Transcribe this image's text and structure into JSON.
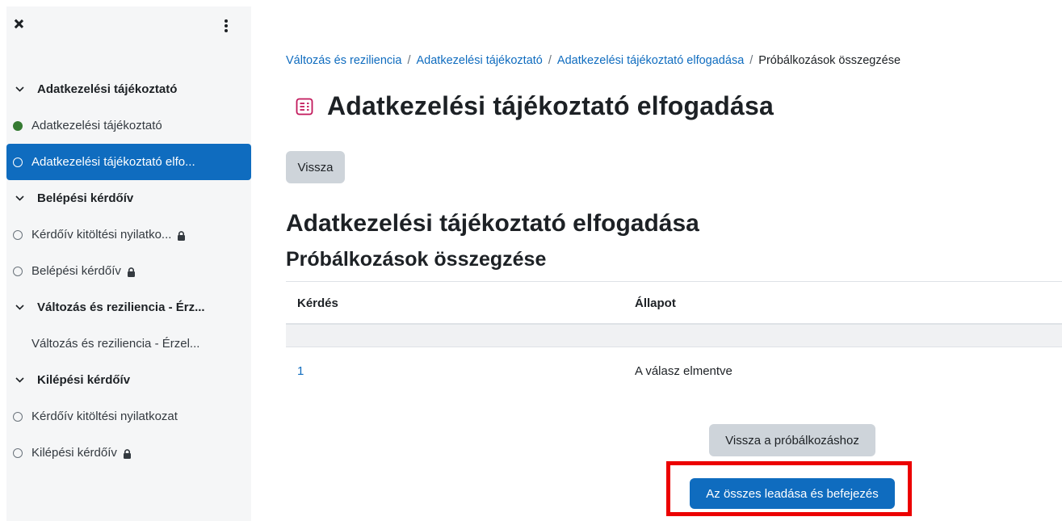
{
  "sidebar": {
    "items": [
      {
        "type": "section",
        "label": "Adatkezelési tájékoztató"
      },
      {
        "type": "item",
        "status": "done",
        "label": "Adatkezelési tájékoztató",
        "locked": false
      },
      {
        "type": "item",
        "status": "active",
        "label": "Adatkezelési tájékoztató elfo...",
        "locked": false
      },
      {
        "type": "section",
        "label": "Belépési kérdőív"
      },
      {
        "type": "item",
        "status": "empty",
        "label": "Kérdőív kitöltési nyilatko...",
        "locked": true
      },
      {
        "type": "item",
        "status": "empty",
        "label": "Belépési kérdőív",
        "locked": true
      },
      {
        "type": "section",
        "label": "Változás és reziliencia - Érz..."
      },
      {
        "type": "item",
        "status": "none",
        "label": "Változás és reziliencia - Érzel...",
        "locked": false
      },
      {
        "type": "section",
        "label": "Kilépési kérdőív"
      },
      {
        "type": "item",
        "status": "empty",
        "label": "Kérdőív kitöltési nyilatkozat",
        "locked": false
      },
      {
        "type": "item",
        "status": "empty",
        "label": "Kilépési kérdőív",
        "locked": true
      }
    ]
  },
  "breadcrumb": [
    {
      "label": "Változás és reziliencia",
      "link": true
    },
    {
      "label": "Adatkezelési tájékoztató",
      "link": true
    },
    {
      "label": "Adatkezelési tájékoztató elfogadása",
      "link": true
    },
    {
      "label": "Próbálkozások összegzése",
      "link": false
    }
  ],
  "page": {
    "title": "Adatkezelési tájékoztató elfogadása",
    "back_label": "Vissza",
    "heading": "Adatkezelési tájékoztató elfogadása",
    "subheading": "Próbálkozások összegzése"
  },
  "table": {
    "headers": [
      "Kérdés",
      "Állapot"
    ],
    "rows": [
      {
        "question": "1",
        "status": "A válasz elmentve"
      }
    ]
  },
  "actions": {
    "return_label": "Vissza a próbálkozáshoz",
    "submit_label": "Az összes leadása és befejezés"
  },
  "colors": {
    "primary": "#0f6cbf",
    "done": "#357a32",
    "highlight": "#ec0000"
  }
}
